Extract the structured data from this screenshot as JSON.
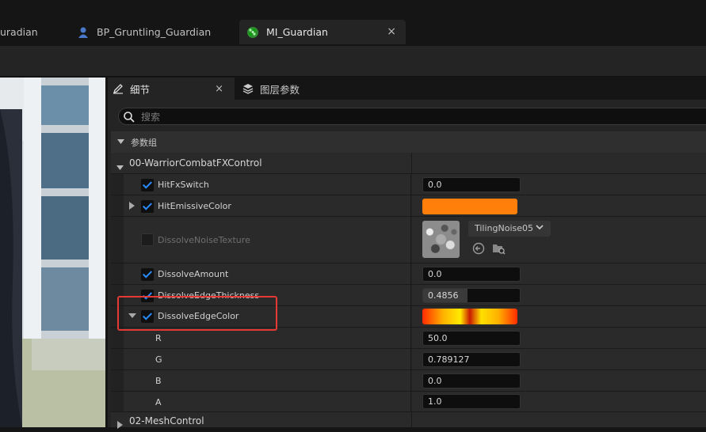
{
  "tabs": [
    {
      "label": "uradian"
    },
    {
      "label": "BP_Gruntling_Guardian",
      "icon": "blueprint-person-icon"
    },
    {
      "label": "MI_Guardian",
      "icon": "material-instance-icon",
      "active": true,
      "close": "×"
    }
  ],
  "panel": {
    "details_tab": "细节",
    "details_close": "×",
    "layers_tab": "图层参数",
    "search_placeholder": "搜索",
    "group_header": "参数组",
    "section": "00-WarriorCombatFXControl",
    "bottom_section": "02-MeshControl"
  },
  "params": {
    "hit_fx_switch": {
      "label": "HitFxSwitch",
      "value": "0.0",
      "checked": true
    },
    "hit_emissive_color": {
      "label": "HitEmissiveColor",
      "checked": true,
      "color": "#ff7f0a"
    },
    "dissolve_noise_texture": {
      "label": "DissolveNoiseTexture",
      "checked": false,
      "texture": "TilingNoise05"
    },
    "dissolve_amount": {
      "label": "DissolveAmount",
      "value": "0.0",
      "checked": true
    },
    "dissolve_edge_thickness": {
      "label": "DissolveEdgeThickness",
      "value": "0.4856",
      "checked": true,
      "fill_fraction": 0.46
    },
    "dissolve_edge_color": {
      "label": "DissolveEdgeColor",
      "checked": true,
      "highlighted": true
    },
    "channels": [
      {
        "label": "R",
        "value": "50.0"
      },
      {
        "label": "G",
        "value": "0.789127"
      },
      {
        "label": "B",
        "value": "0.0"
      },
      {
        "label": "A",
        "value": "1.0"
      }
    ]
  },
  "colors": {
    "accent_check": "#2a8cff",
    "highlight_box": "#e53935",
    "hit_emissive": "#ff7f0a"
  }
}
